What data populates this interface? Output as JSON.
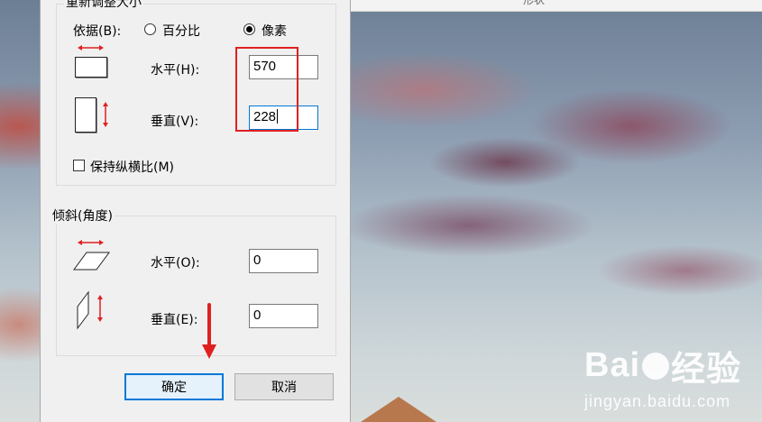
{
  "resize_group": {
    "title": "重新调整大小",
    "by_label": "依据(B):",
    "option_percent": "百分比",
    "option_pixels": "像素",
    "selected": "pixels",
    "horizontal_label": "水平(H):",
    "horizontal_value": "570",
    "vertical_label": "垂直(V):",
    "vertical_value": "228",
    "keep_aspect_label": "保持纵横比(M)",
    "keep_aspect_checked": false
  },
  "skew_group": {
    "title": "倾斜(角度)",
    "horizontal_label": "水平(O):",
    "horizontal_value": "0",
    "vertical_label": "垂直(E):",
    "vertical_value": "0"
  },
  "buttons": {
    "ok": "确定",
    "cancel": "取消"
  },
  "top_bar_text": "形状",
  "watermark": {
    "logo_left": "Bai",
    "logo_right": "经验",
    "url": "jingyan.baidu.com"
  },
  "colors": {
    "accent": "#0078d7",
    "highlight": "#e02020",
    "icon_arrow": "#e02020"
  }
}
